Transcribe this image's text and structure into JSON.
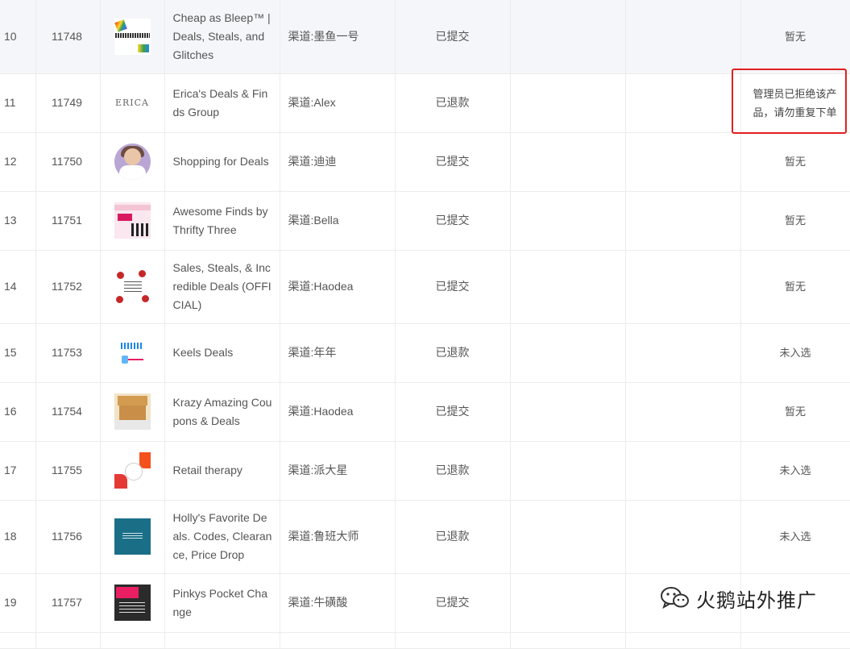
{
  "rows": [
    {
      "idx": "10",
      "id": "11748",
      "name": "Cheap as Bleep™ | Deals, Steals, and Glitches",
      "channel": "渠道:墨鱼一号",
      "status": "已提交",
      "note": "暂无",
      "thumb": "rainbow-logo-thumb"
    },
    {
      "idx": "11",
      "id": "11749",
      "name": "Erica's Deals & Finds Group",
      "channel": "渠道:Alex",
      "status": "已退款",
      "note": "管理员已拒绝该产品，请勿重复下单",
      "thumb_text": "ERICA",
      "thumb": "erica-logo-thumb"
    },
    {
      "idx": "12",
      "id": "11750",
      "name": "Shopping for Deals",
      "channel": "渠道:迪迪",
      "status": "已提交",
      "note": "暂无",
      "thumb": "portrait-thumb"
    },
    {
      "idx": "13",
      "id": "11751",
      "name": "Awesome Finds by Thrifty Three",
      "channel": "渠道:Bella",
      "status": "已提交",
      "note": "暂无",
      "thumb": "group-banner-thumb"
    },
    {
      "idx": "14",
      "id": "11752",
      "name": "Sales, Steals, & Incredible Deals (OFFICIAL)",
      "channel": "渠道:Haodea",
      "status": "已提交",
      "note": "暂无",
      "thumb": "roses-logo-thumb"
    },
    {
      "idx": "15",
      "id": "11753",
      "name": "Keels Deals",
      "channel": "渠道:年年",
      "status": "已退款",
      "note": "未入选",
      "thumb": "keels-logo-thumb"
    },
    {
      "idx": "16",
      "id": "11754",
      "name": "Krazy Amazing Coupons & Deals",
      "channel": "渠道:Haodea",
      "status": "已提交",
      "note": "暂无",
      "thumb": "house-thumb"
    },
    {
      "idx": "17",
      "id": "11755",
      "name": "Retail therapy",
      "channel": "渠道:派大星",
      "status": "已退款",
      "note": "未入选",
      "thumb": "flowers-logo-thumb"
    },
    {
      "idx": "18",
      "id": "11756",
      "name": "Holly's Favorite Deals. Codes, Clearance, Price Drop",
      "channel": "渠道:鲁班大师",
      "status": "已退款",
      "note": "未入选",
      "thumb": "teal-logo-thumb"
    },
    {
      "idx": "19",
      "id": "11757",
      "name": "Pinkys Pocket Change",
      "channel": "渠道:牛磺酸",
      "status": "已提交",
      "note": "",
      "thumb": "pinkys-logo-thumb"
    }
  ],
  "watermark": {
    "text": "火鹅站外推广",
    "icon": "wechat-icon"
  },
  "colors": {
    "highlight_row_bg": "#f5f6fa",
    "annotation_box": "#e02020",
    "grid": "#ececec",
    "text": "#555555"
  }
}
